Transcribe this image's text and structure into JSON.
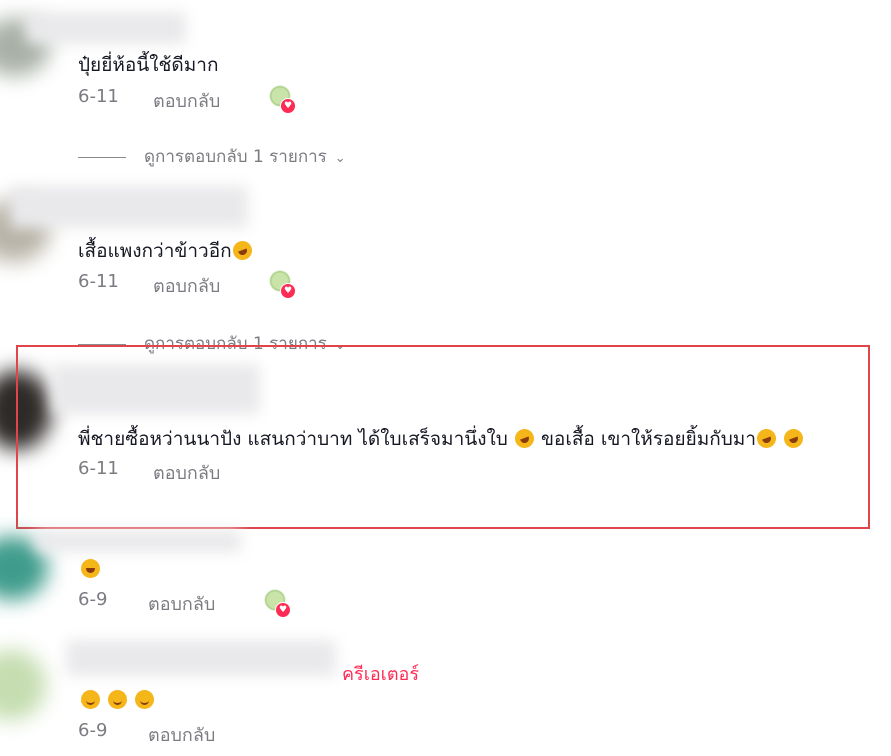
{
  "comments": [
    {
      "text": "ปุ๋ยยี่ห้อนี้ใช้ดีมาก",
      "date": "6-11",
      "reply_label": "ตอบกลับ",
      "view_replies": "ดูการตอบกลับ 1 รายการ",
      "creator_liked": true
    },
    {
      "text": "เสื้อแพงกว่าข้าวอีก",
      "date": "6-11",
      "reply_label": "ตอบกลับ",
      "view_replies": "ดูการตอบกลับ 1 รายการ",
      "creator_liked": true
    },
    {
      "text": "พี่ชายซื้อหว่านนาปัง แสนกว่าบาท ได้ใบเสร็จมานึ่งใบ ",
      "text_b": "ขอเสื้อ เขาให้รอยยิ้มกับมา",
      "date": "6-11",
      "reply_label": "ตอบกลับ",
      "highlighted": true
    },
    {
      "text": "",
      "date": "6-9",
      "reply_label": "ตอบกลับ",
      "creator_liked": true
    },
    {
      "creator_tag": "ครีเอเตอร์",
      "text": "",
      "date": "6-9",
      "reply_label": "ตอบกลับ"
    }
  ],
  "icons": {
    "chevron": "chevron-down-icon",
    "heart": "heart-icon",
    "emoji_rofl": "rolling-on-floor-laughing-emoji",
    "emoji_grin": "grinning-sweat-emoji",
    "emoji_smile": "smiling-blush-emoji"
  },
  "colors": {
    "text": "#161823",
    "muted": "#7b7c82",
    "accent": "#fe2c55",
    "highlight": "#e0454a"
  }
}
